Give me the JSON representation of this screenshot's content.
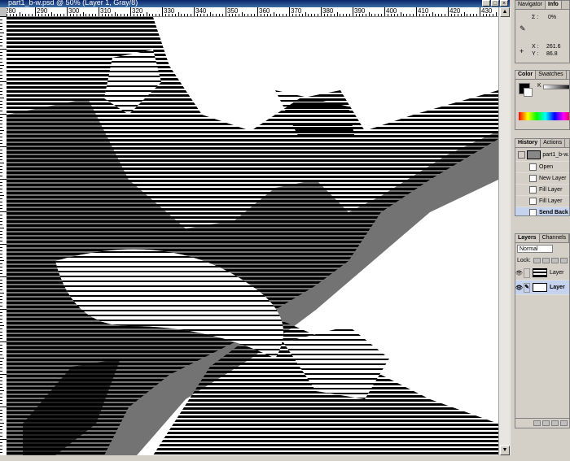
{
  "document": {
    "title": "part1_b-w.psd @ 50% (Layer 1, Gray/8)",
    "ruler_labels": [
      "280",
      "290",
      "300",
      "310",
      "320",
      "330",
      "340",
      "350",
      "360",
      "370",
      "380",
      "390",
      "400",
      "410",
      "420",
      "430"
    ]
  },
  "navigator": {
    "tabs": [
      "Navigator",
      "Info"
    ],
    "sigma_label": "Σ :",
    "sigma_value": "0%",
    "x_label": "X :",
    "x_value": "261.6",
    "y_label": "Y :",
    "y_value": "86.8"
  },
  "color": {
    "tabs": [
      "Color",
      "Swatches"
    ],
    "k_label": "K"
  },
  "history": {
    "tabs": [
      "History",
      "Actions"
    ],
    "snapshot": "part1_b-w.",
    "items": [
      "Open",
      "New Layer",
      "Fill Layer",
      "Fill Layer",
      "Send Back"
    ]
  },
  "layers": {
    "tabs": [
      "Layers",
      "Channels"
    ],
    "blend_mode": "Normal",
    "lock_label": "Lock:",
    "items": [
      "Layer",
      "Layer"
    ]
  },
  "colors": {
    "accent": "#0a246a",
    "selection": "#c6d3ef"
  }
}
